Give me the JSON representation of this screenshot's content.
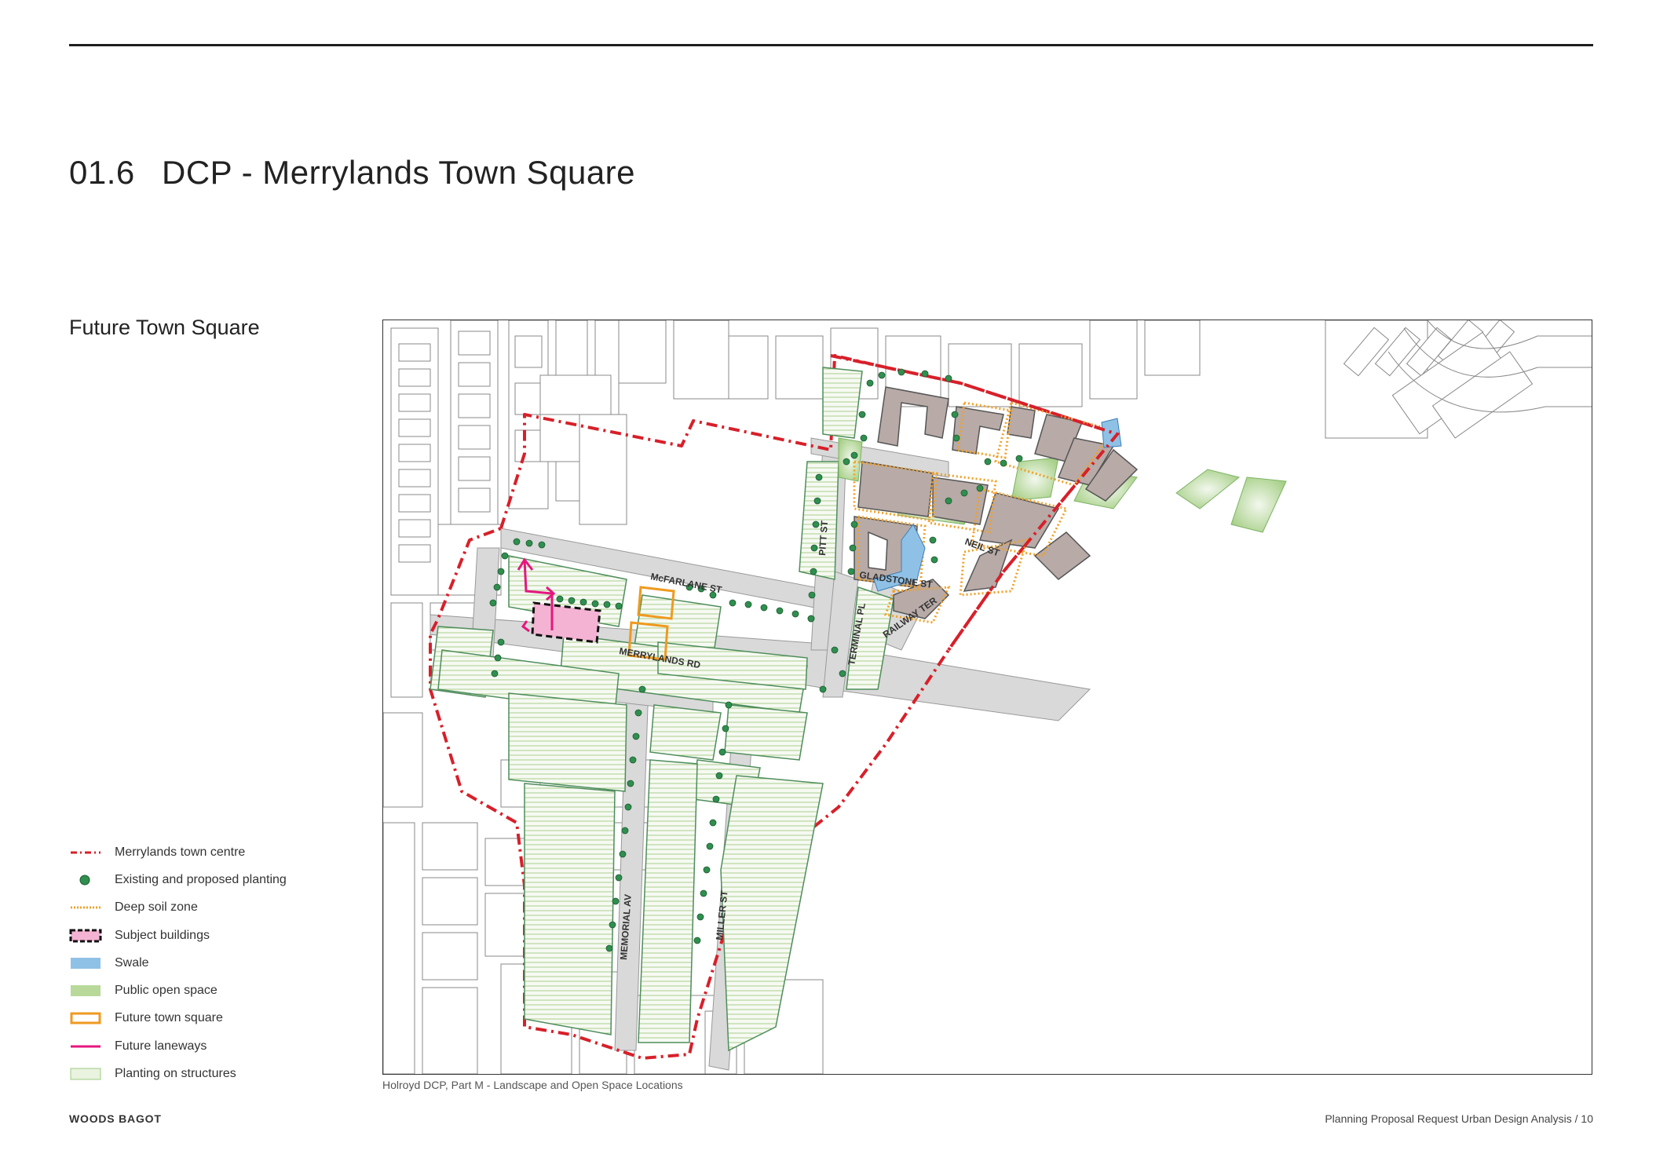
{
  "header": {
    "section_number": "01.6",
    "title": "DCP - Merrylands Town Square"
  },
  "subtitle": "Future Town Square",
  "map": {
    "caption": "Holroyd DCP, Part M - Landscape and Open Space Locations",
    "street_labels": {
      "mcfarlane": "McFARLANE ST",
      "merrylands": "MERRYLANDS RD",
      "memorial": "MEMORIAL AV",
      "miller": "MILLER ST",
      "pitt": "PITT ST",
      "terminal": "TERMINAL PL",
      "railway": "RAILWAY TER",
      "neil": "NEIL ST",
      "gladstone": "GLADSTONE ST"
    }
  },
  "legend": {
    "items": [
      {
        "label": "Merrylands town centre",
        "icon": "red-dash-line-icon"
      },
      {
        "label": "Existing and proposed planting",
        "icon": "green-dot-icon"
      },
      {
        "label": "Deep soil zone",
        "icon": "orange-dotted-line-icon"
      },
      {
        "label": "Subject buildings",
        "icon": "pink-dashed-box-icon"
      },
      {
        "label": "Swale",
        "icon": "blue-swatch-icon"
      },
      {
        "label": "Public open space",
        "icon": "green-swatch-icon"
      },
      {
        "label": "Future town square",
        "icon": "orange-outline-box-icon"
      },
      {
        "label": "Future laneways",
        "icon": "magenta-line-icon"
      },
      {
        "label": "Planting on structures",
        "icon": "light-green-box-icon"
      }
    ]
  },
  "footer": {
    "left": "WOODS BAGOT",
    "right": "Planning Proposal Request Urban Design Analysis  /  10"
  },
  "colors": {
    "town_centre_boundary": "#d7202a",
    "planting": "#2f8f4e",
    "deep_soil": "#f1a12a",
    "subject_building": "#f4b3d3",
    "swale": "#8fc1e6",
    "open_space": "#b8d99a",
    "future_square": "#ef9a1f",
    "laneway": "#e5177f",
    "planting_on_structures": "#e9f3df"
  }
}
